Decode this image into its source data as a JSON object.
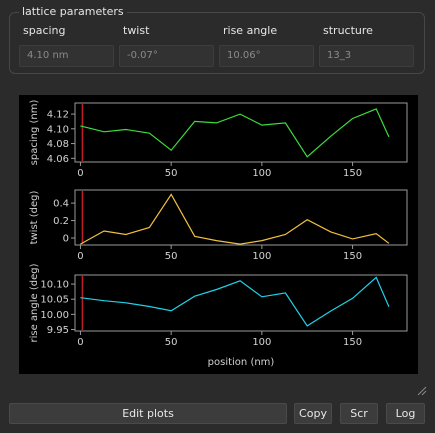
{
  "group": {
    "title": "lattice parameters",
    "params": [
      {
        "label": "spacing",
        "value": "4.10 nm"
      },
      {
        "label": "twist",
        "value": "-0.07°"
      },
      {
        "label": "rise angle",
        "value": "10.06°"
      },
      {
        "label": "structure",
        "value": "13_3"
      }
    ]
  },
  "buttons": {
    "edit_plots": "Edit plots",
    "copy": "Copy",
    "scr": "Scr",
    "log": "Log"
  },
  "colors": {
    "spacing_line": "#3ddc3d",
    "twist_line": "#f0c040",
    "rise_line": "#21d1e8",
    "marker_line": "#c0202a"
  },
  "chart_data": [
    {
      "type": "line",
      "ylabel": "spacing (nm)",
      "xlabel": "",
      "xlim": [
        -3,
        180
      ],
      "ylim": [
        4.055,
        4.135
      ],
      "yticks": [
        "4.06",
        "4.08",
        "4.10",
        "4.12"
      ],
      "xticks": [
        "0",
        "50",
        "100",
        "150"
      ],
      "x": [
        0,
        13,
        25,
        38,
        50,
        63,
        75,
        88,
        100,
        113,
        125,
        138,
        150,
        163,
        170
      ],
      "values": [
        4.104,
        4.096,
        4.099,
        4.094,
        4.071,
        4.11,
        4.108,
        4.12,
        4.105,
        4.108,
        4.062,
        4.09,
        4.114,
        4.127,
        4.089
      ]
    },
    {
      "type": "line",
      "ylabel": "twist (deg)",
      "xlabel": "",
      "xlim": [
        -3,
        180
      ],
      "ylim": [
        -0.08,
        0.55
      ],
      "yticks": [
        "0",
        "0.2",
        "0.4"
      ],
      "xticks": [
        "0",
        "50",
        "100",
        "150"
      ],
      "x": [
        0,
        13,
        25,
        38,
        50,
        63,
        75,
        88,
        100,
        113,
        125,
        138,
        150,
        163,
        170
      ],
      "values": [
        -0.07,
        0.08,
        0.04,
        0.12,
        0.5,
        0.02,
        -0.03,
        -0.07,
        -0.03,
        0.04,
        0.21,
        0.07,
        -0.01,
        0.05,
        -0.06
      ]
    },
    {
      "type": "line",
      "ylabel": "rise angle (deg)",
      "xlabel": "position (nm)",
      "xlim": [
        -3,
        180
      ],
      "ylim": [
        9.945,
        10.13
      ],
      "yticks": [
        "9.95",
        "10.00",
        "10.05",
        "10.10"
      ],
      "xticks": [
        "0",
        "50",
        "100",
        "150"
      ],
      "x": [
        0,
        13,
        25,
        38,
        50,
        63,
        75,
        88,
        100,
        113,
        125,
        138,
        150,
        163,
        170
      ],
      "values": [
        10.055,
        10.045,
        10.038,
        10.026,
        10.012,
        10.06,
        10.082,
        10.111,
        10.058,
        10.071,
        9.962,
        10.011,
        10.053,
        10.122,
        10.025
      ]
    }
  ]
}
